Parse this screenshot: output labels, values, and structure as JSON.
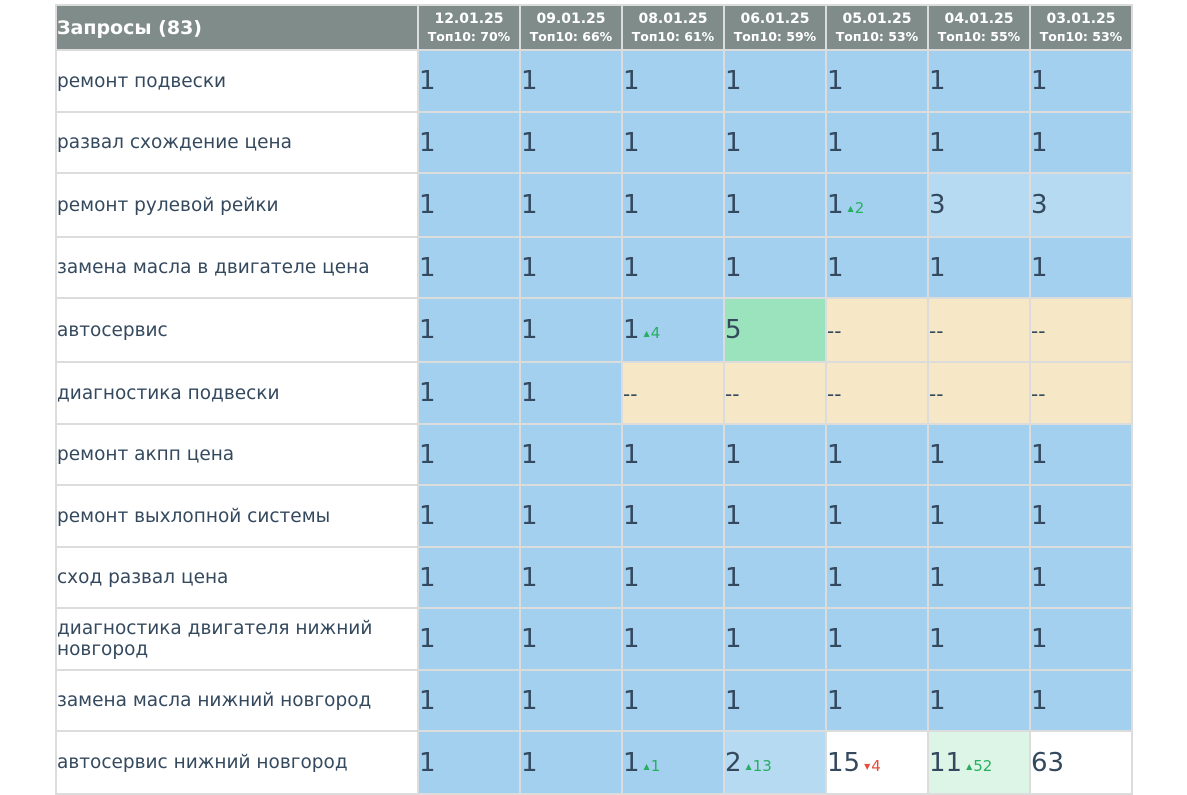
{
  "header": {
    "title": "Запросы (83)",
    "dates": [
      {
        "date": "12.01.25",
        "top": "Топ10: 70%"
      },
      {
        "date": "09.01.25",
        "top": "Топ10: 66%"
      },
      {
        "date": "08.01.25",
        "top": "Топ10: 61%"
      },
      {
        "date": "06.01.25",
        "top": "Топ10: 59%"
      },
      {
        "date": "05.01.25",
        "top": "Топ10: 53%"
      },
      {
        "date": "04.01.25",
        "top": "Топ10: 55%"
      },
      {
        "date": "03.01.25",
        "top": "Топ10: 53%"
      }
    ]
  },
  "colors": {
    "header_bg": "#7f8c8a",
    "top1": "#a3d0ef",
    "top3": "#b5daf1",
    "top5": "#9be3bd",
    "top10": "#ddf5e6",
    "outside": "#ffffff",
    "missing": "#f6e7c6",
    "grid_line": "#dcdcdc",
    "text": "#34495e",
    "up": "#27ae60",
    "down": "#e74c3c"
  },
  "rows": [
    {
      "query": "ремонт подвески",
      "cells": [
        {
          "v": "1",
          "c": "top1"
        },
        {
          "v": "1",
          "c": "top1"
        },
        {
          "v": "1",
          "c": "top1"
        },
        {
          "v": "1",
          "c": "top1"
        },
        {
          "v": "1",
          "c": "top1"
        },
        {
          "v": "1",
          "c": "top1"
        },
        {
          "v": "1",
          "c": "top1"
        }
      ]
    },
    {
      "query": "развал схождение цена",
      "cells": [
        {
          "v": "1",
          "c": "top1"
        },
        {
          "v": "1",
          "c": "top1"
        },
        {
          "v": "1",
          "c": "top1"
        },
        {
          "v": "1",
          "c": "top1"
        },
        {
          "v": "1",
          "c": "top1"
        },
        {
          "v": "1",
          "c": "top1"
        },
        {
          "v": "1",
          "c": "top1"
        }
      ]
    },
    {
      "query": "ремонт рулевой рейки",
      "cells": [
        {
          "v": "1",
          "c": "top1"
        },
        {
          "v": "1",
          "c": "top1"
        },
        {
          "v": "1",
          "c": "top1"
        },
        {
          "v": "1",
          "c": "top1"
        },
        {
          "v": "1",
          "c": "top1",
          "d": "2",
          "dir": "up"
        },
        {
          "v": "3",
          "c": "top3"
        },
        {
          "v": "3",
          "c": "top3"
        }
      ]
    },
    {
      "query": "замена масла в двигателе цена",
      "cells": [
        {
          "v": "1",
          "c": "top1"
        },
        {
          "v": "1",
          "c": "top1"
        },
        {
          "v": "1",
          "c": "top1"
        },
        {
          "v": "1",
          "c": "top1"
        },
        {
          "v": "1",
          "c": "top1"
        },
        {
          "v": "1",
          "c": "top1"
        },
        {
          "v": "1",
          "c": "top1"
        }
      ]
    },
    {
      "query": "автосервис",
      "cells": [
        {
          "v": "1",
          "c": "top1"
        },
        {
          "v": "1",
          "c": "top1"
        },
        {
          "v": "1",
          "c": "top1",
          "d": "4",
          "dir": "up"
        },
        {
          "v": "5",
          "c": "top5"
        },
        {
          "v": "--",
          "c": "missing"
        },
        {
          "v": "--",
          "c": "missing"
        },
        {
          "v": "--",
          "c": "missing"
        }
      ]
    },
    {
      "query": "диагностика подвески",
      "cells": [
        {
          "v": "1",
          "c": "top1"
        },
        {
          "v": "1",
          "c": "top1"
        },
        {
          "v": "--",
          "c": "missing"
        },
        {
          "v": "--",
          "c": "missing"
        },
        {
          "v": "--",
          "c": "missing"
        },
        {
          "v": "--",
          "c": "missing"
        },
        {
          "v": "--",
          "c": "missing"
        }
      ]
    },
    {
      "query": "ремонт акпп цена",
      "cells": [
        {
          "v": "1",
          "c": "top1"
        },
        {
          "v": "1",
          "c": "top1"
        },
        {
          "v": "1",
          "c": "top1"
        },
        {
          "v": "1",
          "c": "top1"
        },
        {
          "v": "1",
          "c": "top1"
        },
        {
          "v": "1",
          "c": "top1"
        },
        {
          "v": "1",
          "c": "top1"
        }
      ]
    },
    {
      "query": "ремонт выхлопной системы",
      "cells": [
        {
          "v": "1",
          "c": "top1"
        },
        {
          "v": "1",
          "c": "top1"
        },
        {
          "v": "1",
          "c": "top1"
        },
        {
          "v": "1",
          "c": "top1"
        },
        {
          "v": "1",
          "c": "top1"
        },
        {
          "v": "1",
          "c": "top1"
        },
        {
          "v": "1",
          "c": "top1"
        }
      ]
    },
    {
      "query": "сход развал цена",
      "cells": [
        {
          "v": "1",
          "c": "top1"
        },
        {
          "v": "1",
          "c": "top1"
        },
        {
          "v": "1",
          "c": "top1"
        },
        {
          "v": "1",
          "c": "top1"
        },
        {
          "v": "1",
          "c": "top1"
        },
        {
          "v": "1",
          "c": "top1"
        },
        {
          "v": "1",
          "c": "top1"
        }
      ]
    },
    {
      "query": "диагностика двигателя нижний новгород",
      "cells": [
        {
          "v": "1",
          "c": "top1"
        },
        {
          "v": "1",
          "c": "top1"
        },
        {
          "v": "1",
          "c": "top1"
        },
        {
          "v": "1",
          "c": "top1"
        },
        {
          "v": "1",
          "c": "top1"
        },
        {
          "v": "1",
          "c": "top1"
        },
        {
          "v": "1",
          "c": "top1"
        }
      ]
    },
    {
      "query": "замена масла нижний новгород",
      "cells": [
        {
          "v": "1",
          "c": "top1"
        },
        {
          "v": "1",
          "c": "top1"
        },
        {
          "v": "1",
          "c": "top1"
        },
        {
          "v": "1",
          "c": "top1"
        },
        {
          "v": "1",
          "c": "top1"
        },
        {
          "v": "1",
          "c": "top1"
        },
        {
          "v": "1",
          "c": "top1"
        }
      ]
    },
    {
      "query": "автосервис нижний новгород",
      "cells": [
        {
          "v": "1",
          "c": "top1"
        },
        {
          "v": "1",
          "c": "top1"
        },
        {
          "v": "1",
          "c": "top1",
          "d": "1",
          "dir": "up"
        },
        {
          "v": "2",
          "c": "top3",
          "d": "13",
          "dir": "up"
        },
        {
          "v": "15",
          "c": "outside",
          "d": "4",
          "dir": "down"
        },
        {
          "v": "11",
          "c": "top10",
          "d": "52",
          "dir": "up"
        },
        {
          "v": "63",
          "c": "outside"
        }
      ]
    }
  ]
}
